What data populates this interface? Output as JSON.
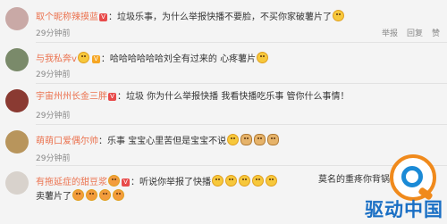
{
  "comments": [
    {
      "name": "取个昵称辣摸蓝",
      "text": "：垃圾乐事，为什么举报快播不要脸，不买你家破薯片了",
      "time": "29分钟前",
      "actions": [
        "举报",
        "回复",
        "赞"
      ]
    },
    {
      "name": "与我私奔v",
      "text": "：哈哈哈哈哈哈刘全有过来的 心疼薯片",
      "time": "29分钟前",
      "actions": []
    },
    {
      "name": "宇宙州州长金三胖",
      "text": "：垃圾 你为什么举报快播 我看快播吃乐事 管你什么事情！",
      "time": "29分钟前",
      "actions": []
    },
    {
      "name": "萌萌口爱偶尔帅",
      "text": "：乐事 宝宝心里苦但是宝宝不说",
      "time": "29分钟前",
      "actions": []
    },
    {
      "name": "有拖延症的甜豆浆",
      "text": "：听说你举报了快播",
      "text2": "莫名的重疼你背锅，好",
      "text3": "卖薯片了",
      "time": "",
      "actions": []
    }
  ],
  "watermark": {
    "text": "驱动中国"
  },
  "colors": {
    "name": "#eb7350",
    "brand_blue": "#1a6fc4",
    "brand_orange": "#f08a1c"
  }
}
